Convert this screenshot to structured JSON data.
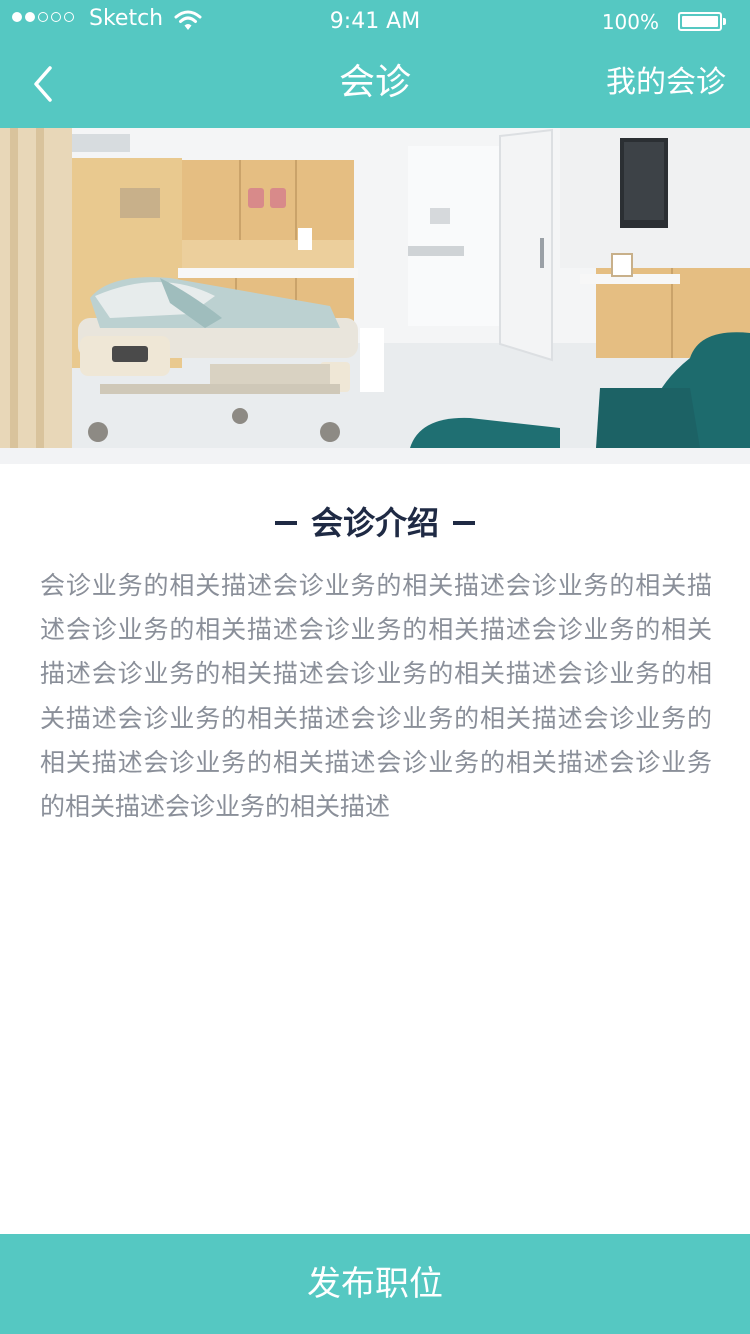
{
  "status_bar": {
    "carrier": "Sketch",
    "time": "9:41 AM",
    "battery_percent": "100%",
    "signal_bars_filled": 2,
    "signal_bars_total": 5,
    "icons": [
      "wifi-icon",
      "battery-icon"
    ]
  },
  "nav": {
    "back_icon": "chevron-left-icon",
    "title": "会诊",
    "right_action": "我的会诊"
  },
  "hero": {
    "image_subject": "hospital-room-photo"
  },
  "intro": {
    "heading": "会诊介绍",
    "body": "会诊业务的相关描述会诊业务的相关描述会诊业务的相关描述会诊业务的相关描述会诊业务的相关描述会诊业务的相关描述会诊业务的相关描述会诊业务的相关描述会诊业务的相关描述会诊业务的相关描述会诊业务的相关描述会诊业务的相关描述会诊业务的相关描述会诊业务的相关描述会诊业务的相关描述会诊业务的相关描述"
  },
  "bottom_action": {
    "label": "发布职位"
  },
  "colors": {
    "primary": "#55c8c2",
    "heading_text": "#1f2a44",
    "body_text": "#8a8f99",
    "divider": "#f2f3f5"
  }
}
